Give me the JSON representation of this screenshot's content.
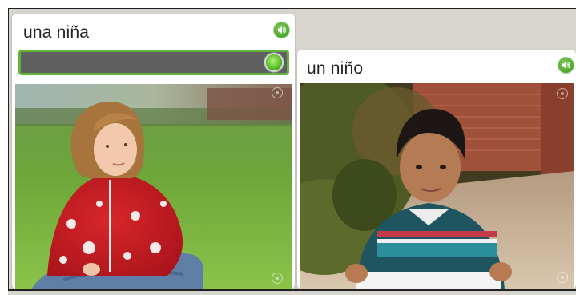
{
  "cards": [
    {
      "word": "una niña",
      "answer_value": "",
      "photo_icon": "photo-placeholder-icon"
    },
    {
      "word": "un niño",
      "photo_icon": "photo-placeholder-icon"
    }
  ],
  "icons": {
    "speaker": "speaker-icon",
    "microphone": "microphone-icon"
  },
  "colors": {
    "accent_green": "#62b33a",
    "input_background": "#5f5f5f",
    "stage_background": "#d8d5cf"
  }
}
